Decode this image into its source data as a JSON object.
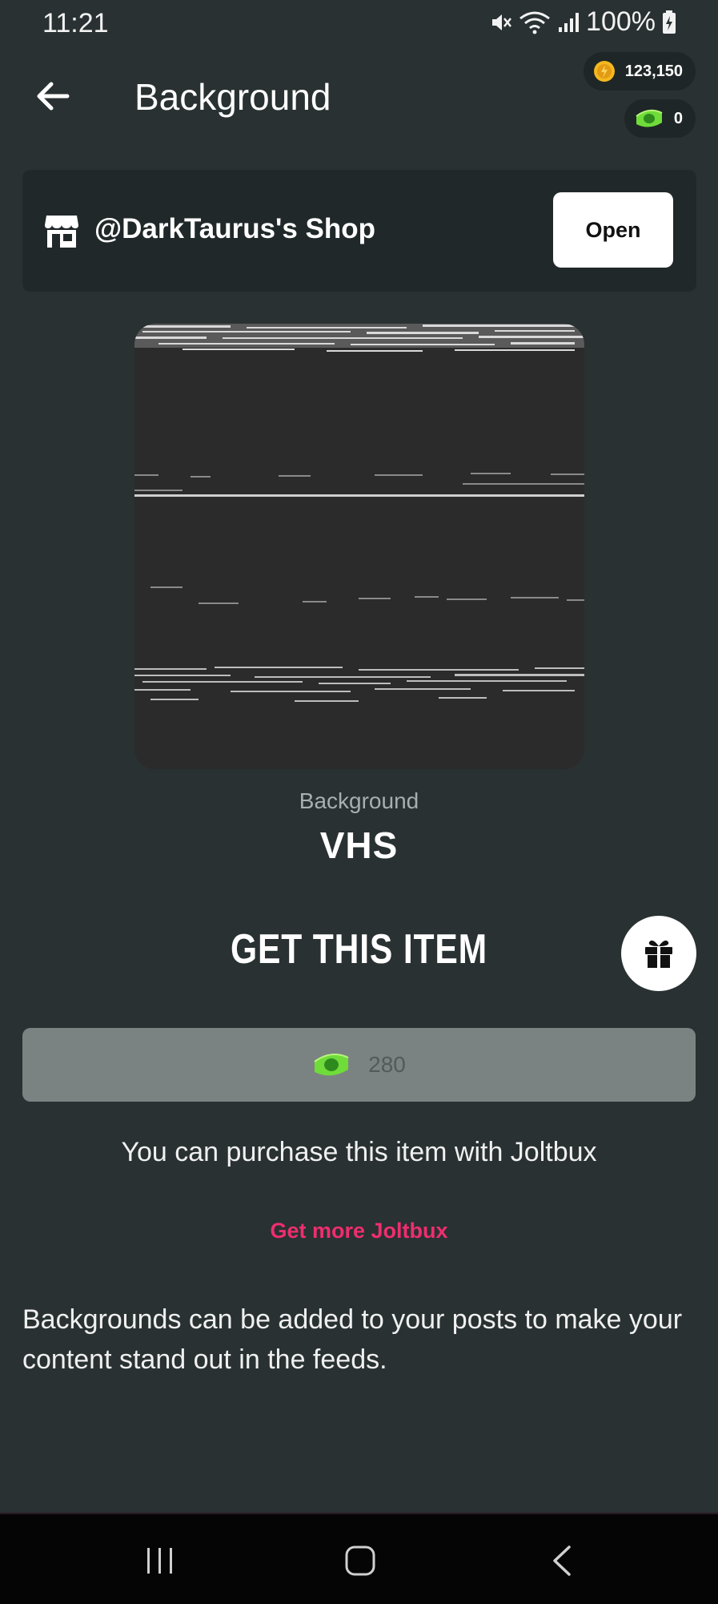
{
  "status_bar": {
    "time": "11:21",
    "battery": "100%"
  },
  "header": {
    "title": "Background",
    "back_icon": "arrow-left-icon"
  },
  "wallet": {
    "coins": "123,150",
    "coins_icon": "coin-icon",
    "joltbux": "0",
    "joltbux_icon": "joltbux-icon",
    "coin_color": "#f5b81f",
    "joltbux_color": "#6fdc3a"
  },
  "shop": {
    "name": "@DarkTaurus's Shop",
    "open_label": "Open",
    "icon": "storefront-icon"
  },
  "item": {
    "category": "Background",
    "name": "VHS"
  },
  "purchase": {
    "heading": "GET THIS ITEM",
    "price": "280",
    "price_icon": "joltbux-icon",
    "gift_icon": "gift-icon",
    "info": "You can purchase this item with Joltbux",
    "more_link": "Get more Joltbux",
    "link_color": "#ee2e6e"
  },
  "description": "Backgrounds can be added to your posts to make your content stand out in the feeds."
}
